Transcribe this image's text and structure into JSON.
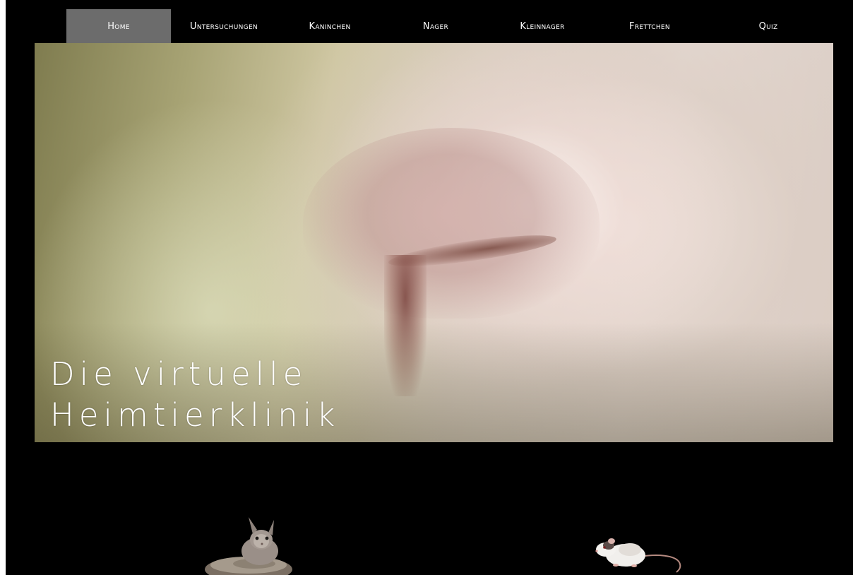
{
  "nav": {
    "items": [
      {
        "label": "Home",
        "active": true
      },
      {
        "label": "Untersuchungen",
        "active": false
      },
      {
        "label": "Kaninchen",
        "active": false
      },
      {
        "label": "Nager",
        "active": false
      },
      {
        "label": "Kleinnager",
        "active": false
      },
      {
        "label": "Frettchen",
        "active": false
      },
      {
        "label": "Quiz",
        "active": false
      }
    ]
  },
  "hero": {
    "title_line1": "Die virtuelle",
    "title_line2": "Heimtierklinik"
  },
  "colors": {
    "background": "#000000",
    "nav_active": "#6c6c6c",
    "text": "#ffffff"
  },
  "icons": {
    "rabbit": "rabbit-image",
    "mouse": "mouse-image"
  }
}
